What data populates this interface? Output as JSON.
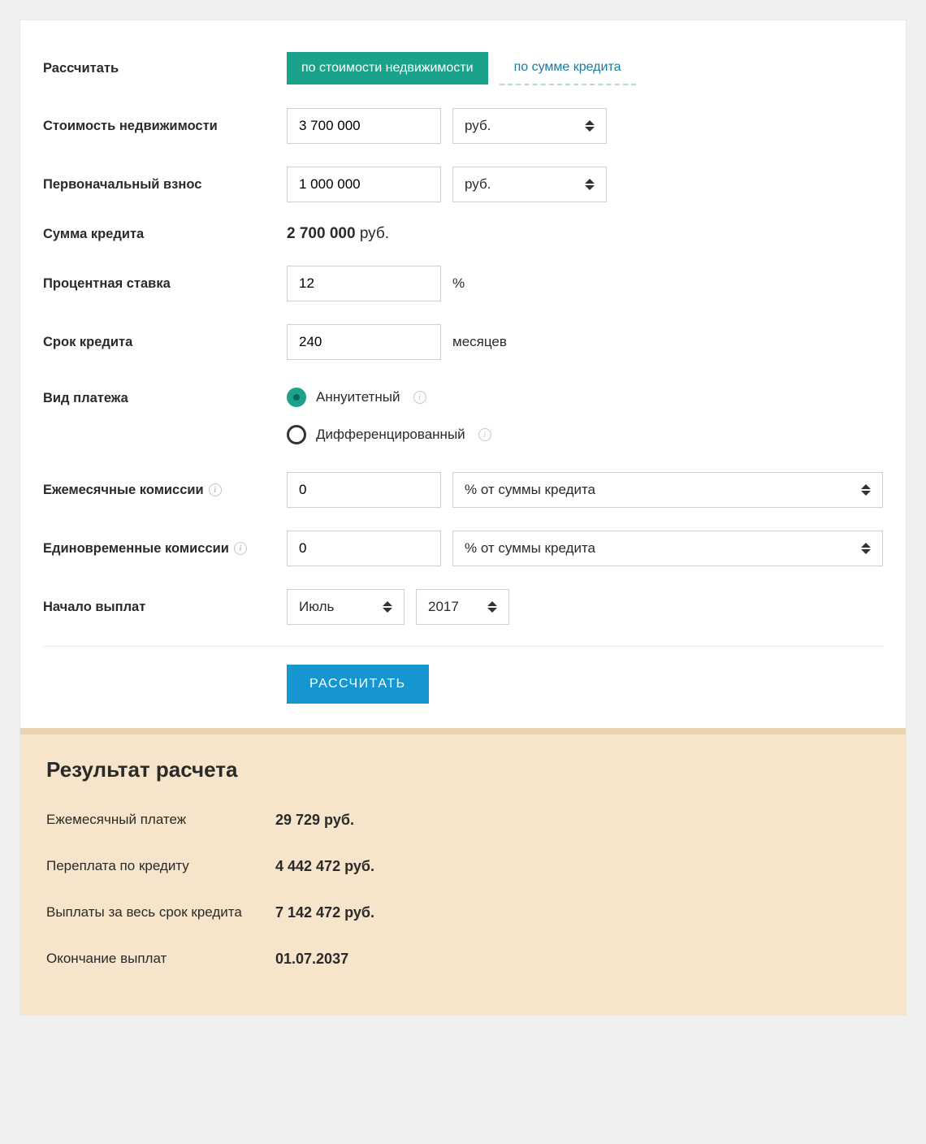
{
  "form": {
    "calc_mode": {
      "label": "Рассчитать",
      "tab_active": "по стоимости недвижимости",
      "tab_inactive": "по сумме кредита"
    },
    "property_cost": {
      "label": "Стоимость недвижимости",
      "value": "3 700 000",
      "unit": "руб."
    },
    "down_payment": {
      "label": "Первоначальный взнос",
      "value": "1 000 000",
      "unit": "руб."
    },
    "loan_amount": {
      "label": "Сумма кредита",
      "value": "2 700 000",
      "unit": "руб."
    },
    "rate": {
      "label": "Процентная ставка",
      "value": "12",
      "suffix": "%"
    },
    "term": {
      "label": "Срок кредита",
      "value": "240",
      "suffix": "месяцев"
    },
    "payment_type": {
      "label": "Вид платежа",
      "option_annuity": "Аннуитетный",
      "option_differential": "Дифференцированный"
    },
    "monthly_fee": {
      "label": "Ежемесячные комиссии",
      "value": "0",
      "unit": "% от суммы кредита"
    },
    "onetime_fee": {
      "label": "Единовременные комиссии",
      "value": "0",
      "unit": "% от суммы кредита"
    },
    "start": {
      "label": "Начало выплат",
      "month": "Июль",
      "year": "2017"
    },
    "submit": "РАССЧИТАТЬ"
  },
  "results": {
    "heading": "Результат расчета",
    "monthly": {
      "label": "Ежемесячный платеж",
      "value": "29 729 руб."
    },
    "overpay": {
      "label": "Переплата по кредиту",
      "value": "4 442 472 руб."
    },
    "total": {
      "label": "Выплаты за весь срок кредита",
      "value": "7 142 472 руб."
    },
    "end": {
      "label": "Окончание выплат",
      "value": "01.07.2037"
    }
  }
}
